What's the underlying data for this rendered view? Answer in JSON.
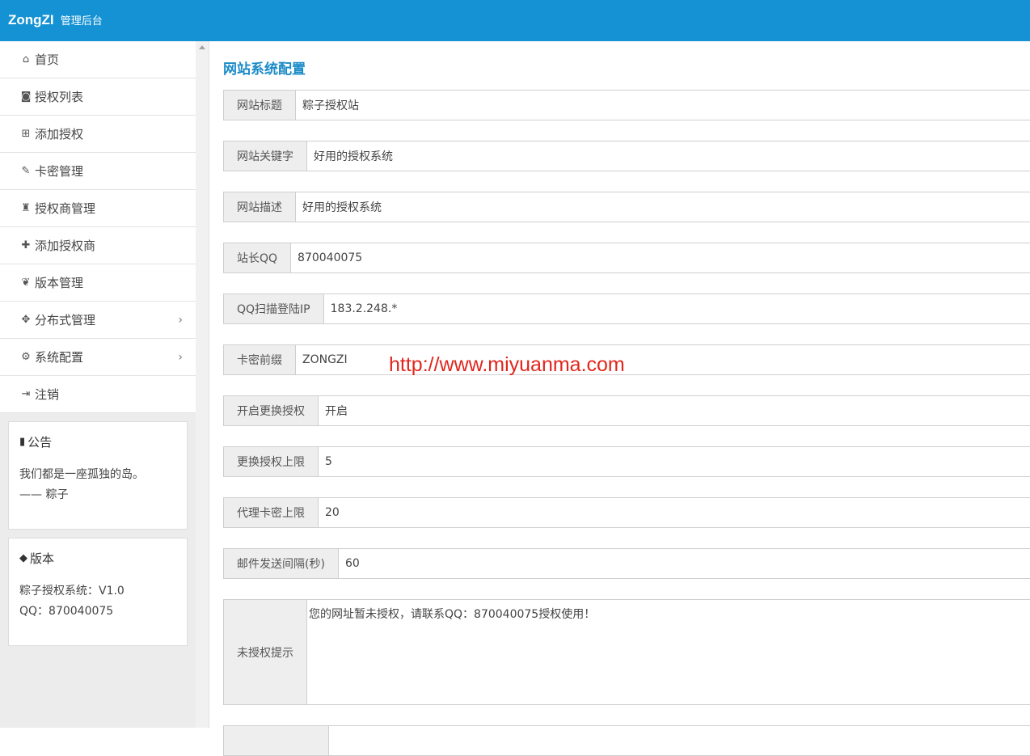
{
  "header": {
    "logo": "ZongZI",
    "subtitle": "管理后台",
    "bg_color": "#1592d3"
  },
  "sidebar": {
    "items": [
      {
        "label": "首页",
        "icon": "home-icon",
        "glyph": "⌂"
      },
      {
        "label": "授权列表",
        "icon": "pocket-icon",
        "glyph": "◙"
      },
      {
        "label": "添加授权",
        "icon": "plus-square-icon",
        "glyph": "⊞"
      },
      {
        "label": "卡密管理",
        "icon": "edit-icon",
        "glyph": "✎"
      },
      {
        "label": "授权商管理",
        "icon": "user-secret-icon",
        "glyph": "♜"
      },
      {
        "label": "添加授权商",
        "icon": "user-plus-icon",
        "glyph": "✚"
      },
      {
        "label": "版本管理",
        "icon": "leaf-icon",
        "glyph": "❦"
      },
      {
        "label": "分布式管理",
        "icon": "puzzle-icon",
        "glyph": "✥"
      },
      {
        "label": "系统配置",
        "icon": "gear-icon",
        "glyph": "⚙"
      },
      {
        "label": "注销",
        "icon": "sign-out-icon",
        "glyph": "⇥"
      }
    ],
    "notice": {
      "title": "公告",
      "icon": "bookmark-icon",
      "lines": [
        "我们都是一座孤独的岛。",
        "—— 粽子"
      ]
    },
    "version": {
      "title": "版本",
      "icon": "tag-icon",
      "lines": [
        "粽子授权系统：V1.0",
        "QQ：870040075"
      ]
    }
  },
  "main": {
    "title": "网站系统配置",
    "fields": [
      {
        "label": "网站标题",
        "value": "粽子授权站"
      },
      {
        "label": "网站关键字",
        "value": "好用的授权系统"
      },
      {
        "label": "网站描述",
        "value": "好用的授权系统"
      },
      {
        "label": "站长QQ",
        "value": "870040075"
      },
      {
        "label": "QQ扫描登陆IP",
        "value": "183.2.248.*"
      },
      {
        "label": "卡密前缀",
        "value": "ZONGZI"
      },
      {
        "label": "开启更换授权",
        "value": "开启"
      },
      {
        "label": "更换授权上限",
        "value": "5"
      },
      {
        "label": "代理卡密上限",
        "value": "20"
      },
      {
        "label": "邮件发送间隔(秒)",
        "value": "60"
      }
    ],
    "textarea": {
      "label": "未授权提示",
      "value": "您的网址暂未授权，请联系QQ：870040075授权使用！"
    }
  },
  "watermark": "http://www.miyuanma.com",
  "colors": {
    "accent": "#1a8bc7",
    "watermark": "#e0261d"
  }
}
